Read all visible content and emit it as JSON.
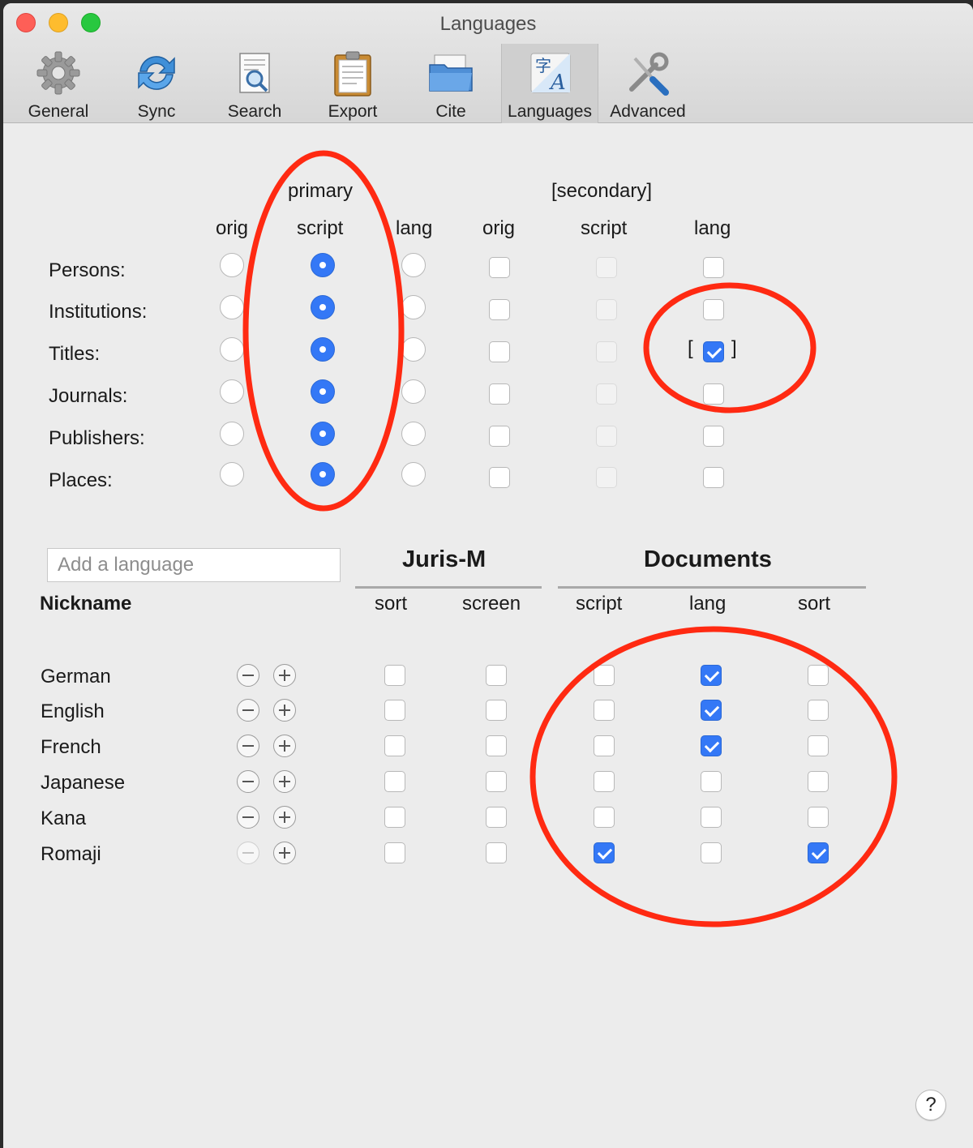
{
  "window": {
    "title": "Languages"
  },
  "toolbar": [
    {
      "label": "General",
      "icon": "gear-icon"
    },
    {
      "label": "Sync",
      "icon": "sync-icon"
    },
    {
      "label": "Search",
      "icon": "search-icon"
    },
    {
      "label": "Export",
      "icon": "clipboard-icon"
    },
    {
      "label": "Cite",
      "icon": "folder-icon"
    },
    {
      "label": "Languages",
      "icon": "languages-icon",
      "active": true
    },
    {
      "label": "Advanced",
      "icon": "tools-icon"
    }
  ],
  "variants": {
    "primary_header": "primary",
    "secondary_header": "[secondary]",
    "columns": [
      "orig",
      "script",
      "lang",
      "orig",
      "script",
      "lang"
    ],
    "rows": [
      {
        "label": "Persons:",
        "primary": "script",
        "secondary": [
          false,
          false,
          false
        ]
      },
      {
        "label": "Institutions:",
        "primary": "script",
        "secondary": [
          false,
          false,
          false
        ]
      },
      {
        "label": "Titles:",
        "primary": "script",
        "secondary": [
          false,
          false,
          true
        ]
      },
      {
        "label": "Journals:",
        "primary": "script",
        "secondary": [
          false,
          false,
          false
        ]
      },
      {
        "label": "Publishers:",
        "primary": "script",
        "secondary": [
          false,
          false,
          false
        ]
      },
      {
        "label": "Places:",
        "primary": "script",
        "secondary": [
          false,
          false,
          false
        ]
      }
    ],
    "bracket_open": "[",
    "bracket_close": "]"
  },
  "languages": {
    "input_placeholder": "Add a language",
    "nickname_header": "Nickname",
    "jurism_header": "Juris-M",
    "documents_header": "Documents",
    "columns": [
      "sort",
      "screen",
      "script",
      "lang",
      "sort"
    ],
    "rows": [
      {
        "name": "German",
        "can_remove": true,
        "values": [
          false,
          false,
          false,
          true,
          false
        ]
      },
      {
        "name": "English",
        "can_remove": true,
        "values": [
          false,
          false,
          false,
          true,
          false
        ]
      },
      {
        "name": "French",
        "can_remove": true,
        "values": [
          false,
          false,
          false,
          true,
          false
        ]
      },
      {
        "name": "Japanese",
        "can_remove": true,
        "values": [
          false,
          false,
          false,
          false,
          false
        ]
      },
      {
        "name": "Kana",
        "can_remove": true,
        "values": [
          false,
          false,
          false,
          false,
          false
        ]
      },
      {
        "name": "Romaji",
        "can_remove": false,
        "values": [
          false,
          false,
          true,
          false,
          true
        ]
      }
    ]
  },
  "help_label": "?",
  "colors": {
    "accent": "#3478f6",
    "annotation": "#ff2a12"
  }
}
